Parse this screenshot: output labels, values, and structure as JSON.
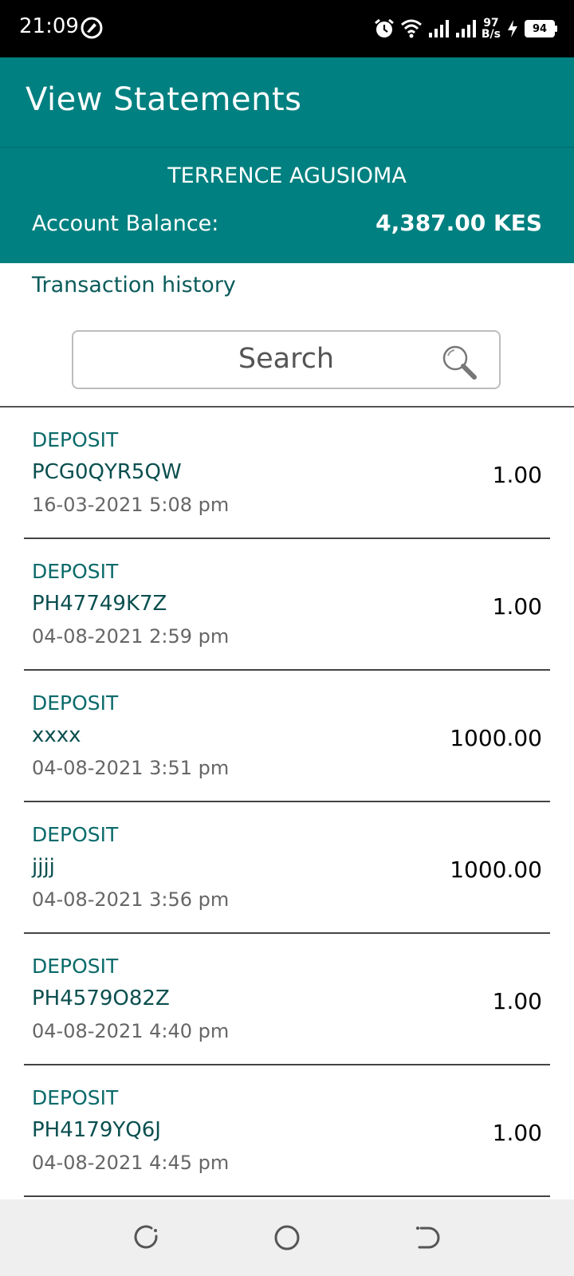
{
  "status_bar": {
    "time": "21:09",
    "net_speed_value": "97",
    "net_speed_unit": "B/s",
    "battery": "94",
    "icons": [
      "vpn-icon",
      "alarm-icon",
      "wifi-icon",
      "signal-icon",
      "signal-icon",
      "charging-icon",
      "battery-icon"
    ]
  },
  "app_bar": {
    "title": "View Statements"
  },
  "account": {
    "name": "TERRENCE AGUSIOMA",
    "balance_label": "Account Balance:",
    "balance_value": "4,387.00 KES"
  },
  "history": {
    "title": "Transaction history"
  },
  "search": {
    "placeholder": "Search"
  },
  "transactions": [
    {
      "type": "DEPOSIT",
      "ref": "PCG0QYR5QW",
      "date": "16-03-2021 5:08 pm",
      "amount": "1.00"
    },
    {
      "type": "DEPOSIT",
      "ref": "PH47749K7Z",
      "date": "04-08-2021 2:59 pm",
      "amount": "1.00"
    },
    {
      "type": "DEPOSIT",
      "ref": "xxxx",
      "date": "04-08-2021 3:51 pm",
      "amount": "1000.00"
    },
    {
      "type": "DEPOSIT",
      "ref": "jjjj",
      "date": "04-08-2021 3:56 pm",
      "amount": "1000.00"
    },
    {
      "type": "DEPOSIT",
      "ref": "PH4579O82Z",
      "date": "04-08-2021 4:40 pm",
      "amount": "1.00"
    },
    {
      "type": "DEPOSIT",
      "ref": "PH4179YQ6J",
      "date": "04-08-2021 4:45 pm",
      "amount": "1.00"
    }
  ],
  "colors": {
    "primary": "#008080",
    "text_teal": "#0b5b5b"
  }
}
